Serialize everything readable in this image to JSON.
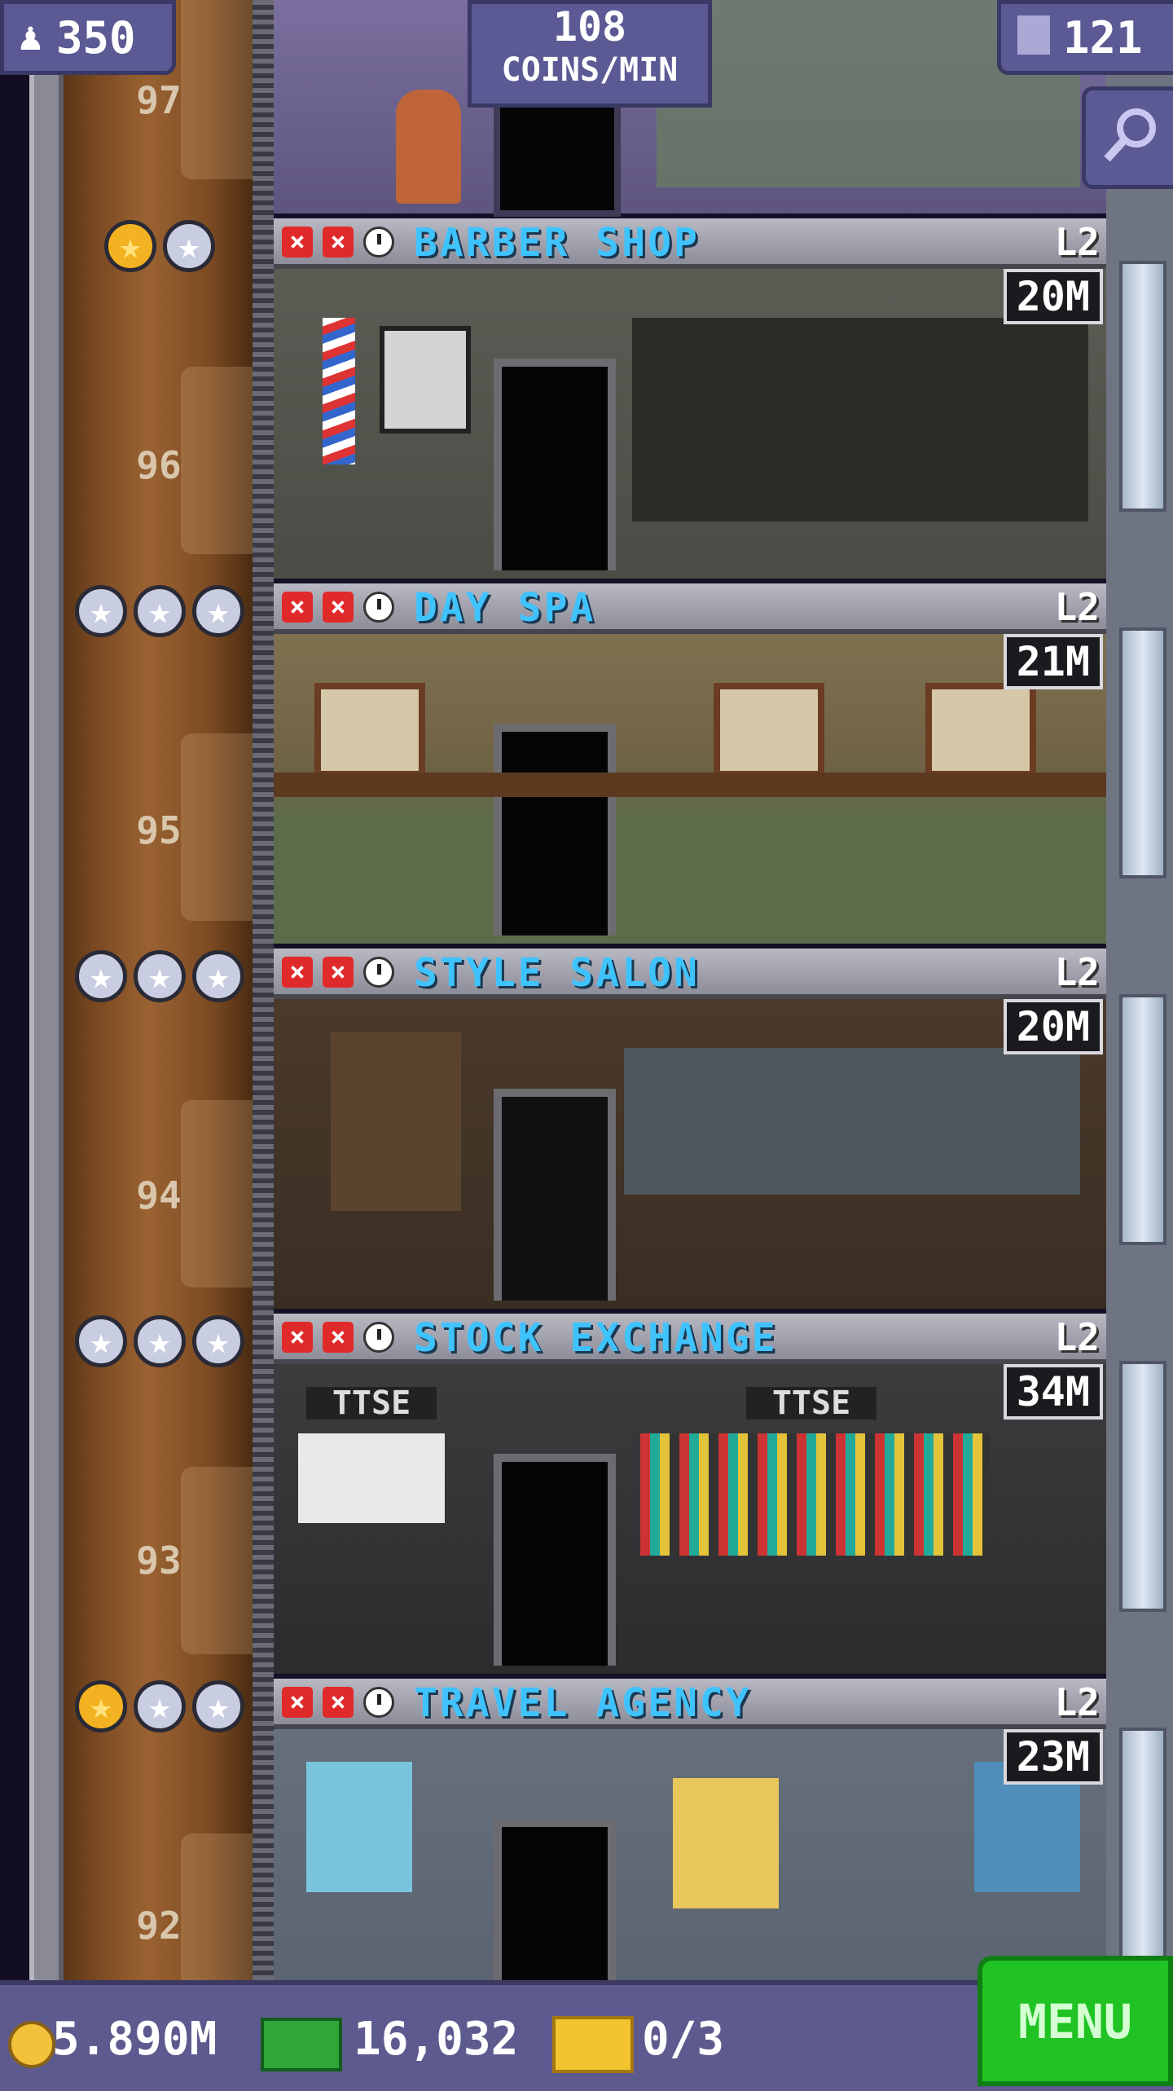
{
  "hud": {
    "population": "350",
    "coins_rate_value": "108",
    "coins_rate_unit": "COINS/MIN",
    "floors_count": "121"
  },
  "floors": [
    {
      "number": "97"
    },
    {
      "number": "96",
      "name": "BARBER SHOP",
      "level": "L2",
      "timer": "20M",
      "stars": [
        "gold",
        "silver"
      ]
    },
    {
      "number": "95",
      "name": "DAY SPA",
      "level": "L2",
      "timer": "21M",
      "stars": [
        "silver",
        "silver",
        "silver"
      ]
    },
    {
      "number": "94",
      "name": "STYLE SALON",
      "level": "L2",
      "timer": "20M",
      "stars": [
        "silver",
        "silver",
        "silver"
      ]
    },
    {
      "number": "93",
      "name": "STOCK EXCHANGE",
      "level": "L2",
      "timer": "34M",
      "stars": [
        "silver",
        "silver",
        "silver"
      ]
    },
    {
      "number": "92",
      "name": "TRAVEL AGENCY",
      "level": "L2",
      "timer": "23M",
      "stars": [
        "gold",
        "silver",
        "silver"
      ]
    }
  ],
  "room_text": {
    "stock_sign_left": "TTSE",
    "stock_sign_right": "TTSE"
  },
  "bottom": {
    "coins": "5.890M",
    "bux": "16,032",
    "tickets": "0/3",
    "menu_label": "MENU"
  },
  "colors": {
    "floor_name": "#3fc3ff",
    "menu_button": "#20c323",
    "hud_bg": "#5b5a94"
  }
}
